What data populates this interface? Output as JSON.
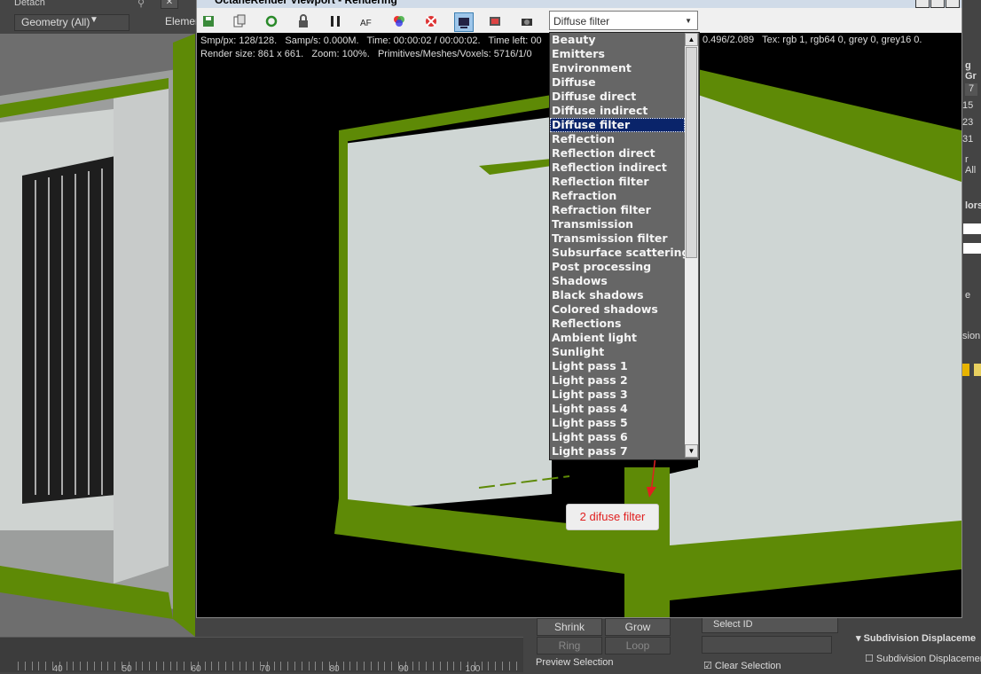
{
  "background_ui": {
    "detach_label": "Detach",
    "geometry_dropdown": "Geometry (All)",
    "element_label": "Elemen",
    "timeline_labels": [
      "40",
      "50",
      "60",
      "70",
      "80",
      "90",
      "100"
    ],
    "right_panel": {
      "nums": [
        "7",
        "15",
        "23",
        "31"
      ],
      "texts": [
        "g Gr",
        "r All",
        "lors",
        "e",
        "sion"
      ]
    },
    "bottom": {
      "shrink": "Shrink",
      "grow": "Grow",
      "ring": "Ring",
      "loop": "Loop",
      "preview_selection": "Preview Selection",
      "select_id": "Select ID",
      "clear_selection": "Clear Selection",
      "subdivision_displacement_header": "Subdivision Displaceme",
      "subdivision_displacement_check": "Subdivision Displacemen"
    }
  },
  "octane": {
    "title": "OctaneRender Viewport - Rendering",
    "toolbar_icons": [
      "save-render-icon",
      "copy-icon",
      "refresh-icon",
      "lock-icon",
      "pause-icon",
      "autofocus-icon",
      "color-icon",
      "region-icon",
      "viewport-icon",
      "film-icon",
      "camera-icon"
    ],
    "selected_pass": "Diffuse filter",
    "stats_line1": "Smp/px: 128/128.   Samp/s: 0.000M.   Time: 00:00:02 / 00:00:02.   Time left: 00",
    "stats_line2": "Render size: 861 x 661.   Zoom: 100%.   Primitives/Meshes/Voxels: 5716/1/0",
    "stats_right": "0.496/2.089   Tex: rgb 1, rgb64 0, grey 0, grey16 0.",
    "passes": [
      "Beauty",
      "Emitters",
      "Environment",
      "Diffuse",
      "Diffuse direct",
      "Diffuse indirect",
      "Diffuse filter",
      "Reflection",
      "Reflection direct",
      "Reflection indirect",
      "Reflection filter",
      "Refraction",
      "Refraction filter",
      "Transmission",
      "Transmission filter",
      "Subsurface scattering",
      "Post processing",
      "Shadows",
      "Black shadows",
      "Colored shadows",
      "Reflections",
      "Ambient light",
      "Sunlight",
      "Light pass 1",
      "Light pass 2",
      "Light pass 3",
      "Light pass 4",
      "Light pass 5",
      "Light pass 6",
      "Light pass 7"
    ],
    "selected_index": 6
  },
  "annotation": {
    "text": "2 difuse filter",
    "color": "#e02020"
  },
  "colors": {
    "container_green": "#5e8a06",
    "container_wall": "#cfd6d4",
    "selection": "#0a246a"
  }
}
